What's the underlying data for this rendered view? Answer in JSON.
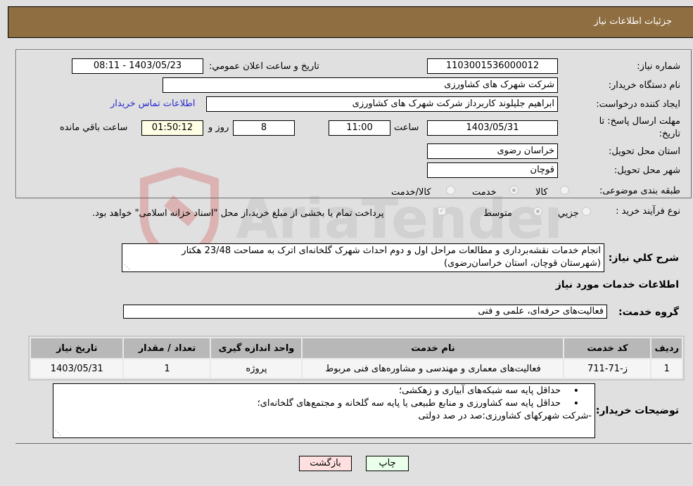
{
  "header": {
    "title": "جزئیات اطلاعات نیاز"
  },
  "form": {
    "need_number": {
      "label": "شماره نیاز:",
      "value": "1103001536000012"
    },
    "announce_datetime": {
      "label": "تاریخ و ساعت اعلان عمومي:",
      "value": "1403/05/23 - 08:11"
    },
    "buyer_org": {
      "label": "نام دستگاه خريدار:",
      "value": "شرکت شهرک های کشاورزی"
    },
    "requester": {
      "label": "ايجاد کننده درخواست:",
      "value": "ابراهیم جلیلوند کاربرداز شرکت شهرک های کشاورزی"
    },
    "buyer_contact_link": "اطلاعات تماس خريدار",
    "deadline": {
      "label_line1": "مهلت ارسال پاسخ: تا",
      "label_line2": "تاريخ:",
      "date": "1403/05/31",
      "time_label": "ساعت",
      "time": "11:00",
      "days": "8",
      "days_label": "روز و",
      "remaining": "01:50:12",
      "remaining_label": "ساعت باقي مانده"
    },
    "province": {
      "label": "استان محل تحويل:",
      "value": "خراسان رضوی"
    },
    "city": {
      "label": "شهر محل تحويل:",
      "value": "قوچان"
    },
    "category": {
      "label": "طبقه بندی موضوعی:",
      "options": [
        "کالا",
        "خدمت",
        "کالا/خدمت"
      ],
      "selected": "خدمت"
    },
    "purchase_process": {
      "label": "نوع فرآيند خريد :",
      "options": [
        "جزيي",
        "متوسط"
      ],
      "selected": "متوسط",
      "treasury_checkbox_label": "پرداخت تمام يا بخشی از مبلغ خريد،از محل \"اسناد خزانه اسلامی\" خواهد بود.",
      "treasury_checked": true
    }
  },
  "description": {
    "label": "شرح کلي نياز:",
    "line1": "انجام خدمات نقشه‌برداری و مطالعات مراحل اول و دوم احداث شهرک گلخانه‌ای اترک  به مساحت 23/48 هکتار",
    "line2": "(شهرستان قوچان، استان خراسان‌رضوی)"
  },
  "services": {
    "section_title": "اطلاعات خدمات مورد نياز",
    "group_label": "گروه خدمت:",
    "group_value": "فعاليت‌های حرفه‌ای، علمی و فنی",
    "table": {
      "headers": [
        "رديف",
        "کد خدمت",
        "نام خدمت",
        "واحد اندازه گيری",
        "تعداد / مقدار",
        "تاريخ نياز"
      ],
      "rows": [
        [
          "1",
          "ز-71-711",
          "فعاليت‌های معماری و مهندسی و مشاوره‌های فنی مربوط",
          "پروژه",
          "1",
          "1403/05/31"
        ]
      ]
    }
  },
  "buyer_notes": {
    "label": "توضيحات خريدار:",
    "bullets": [
      "حداقل پایه سه شبکه‌های آبیاری و زهکشی؛",
      "حداقل پایه سه کشاورزی و منابع طبیعی یا پایه سه گلخانه و مجتمع‌های گلخانه‌ای؛"
    ],
    "extra_line": "-شرکت شهرکهای کشاورزی:صد در صد دولتی"
  },
  "buttons": {
    "print": "چاپ",
    "back": "بازگشت"
  }
}
